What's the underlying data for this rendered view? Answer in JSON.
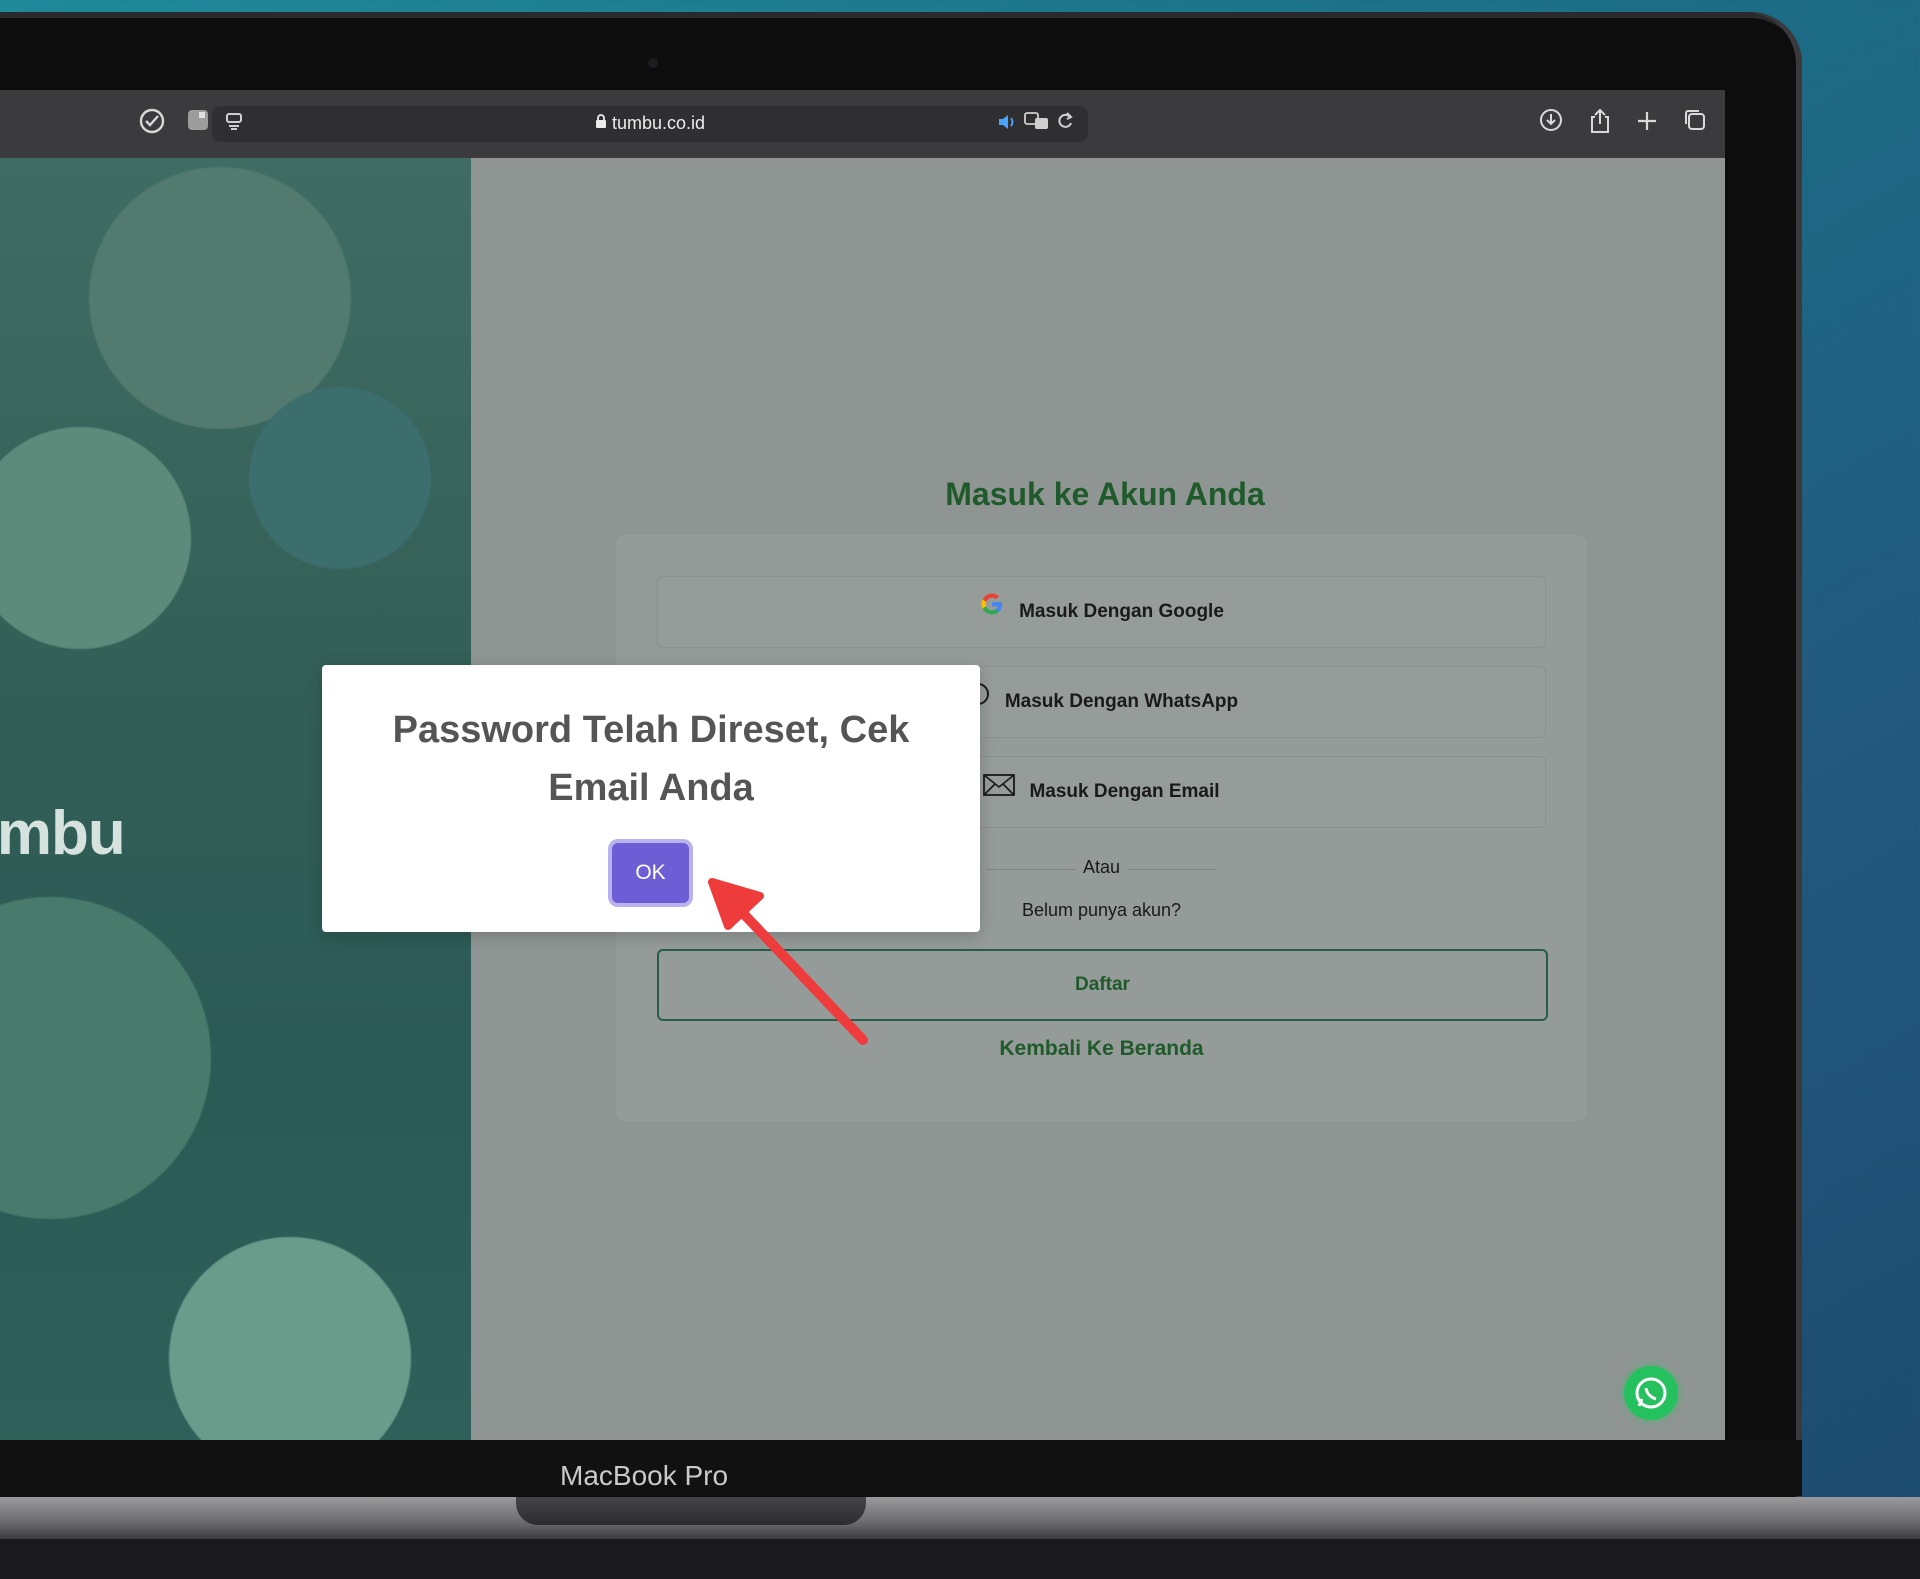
{
  "browser": {
    "url": "tumbu.co.id",
    "lock_icon": "lock-icon"
  },
  "page": {
    "photo_word": "umbu",
    "form": {
      "title": "Masuk ke Akun Anda",
      "google_label": "Masuk Dengan Google",
      "whatsapp_label": "Masuk Dengan WhatsApp",
      "email_label": "Masuk Dengan Email",
      "divider_text": "Atau",
      "no_account_text": "Belum punya akun?",
      "register_label": "Daftar",
      "back_label": "Kembali Ke Beranda"
    }
  },
  "dialog": {
    "title": "Password Telah Direset, Cek Email Anda",
    "ok_label": "OK"
  },
  "device": {
    "brand": "MacBook Pro"
  },
  "colors": {
    "brand_green": "#1f5a2a",
    "ok_button": "#6d5ed6",
    "whatsapp": "#25c15f",
    "annotation_arrow": "#ee3b3b"
  }
}
